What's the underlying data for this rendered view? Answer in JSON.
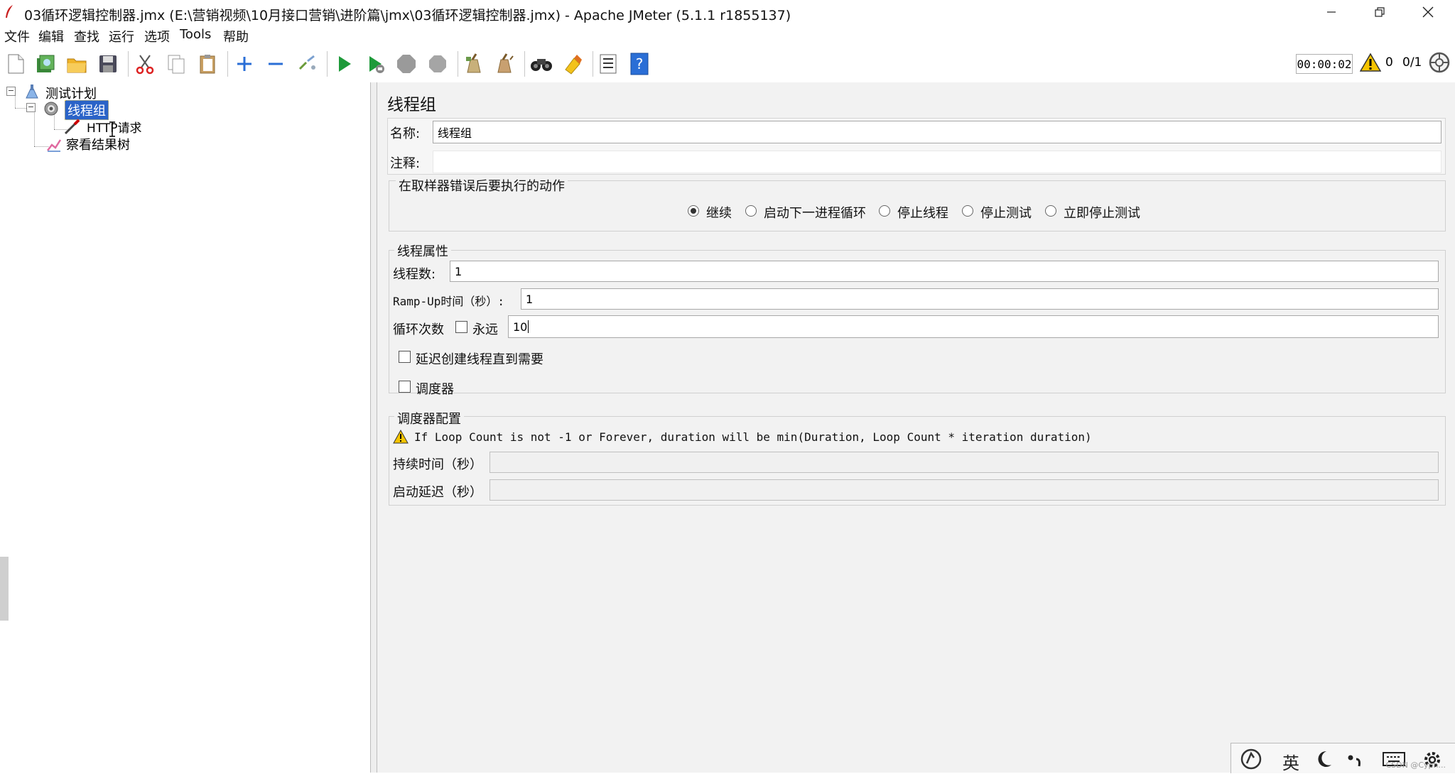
{
  "window": {
    "title": "03循环逻辑控制器.jmx (E:\\营销视频\\10月接口营销\\进阶篇\\jmx\\03循环逻辑控制器.jmx) - Apache JMeter (5.1.1 r1855137)"
  },
  "menu": [
    "文件",
    "编辑",
    "查找",
    "运行",
    "选项",
    "Tools",
    "帮助"
  ],
  "toolbar": {
    "icons": [
      "new-icon",
      "templates-icon",
      "open-icon",
      "save-icon",
      "cut-icon",
      "copy-icon",
      "paste-icon",
      "expand-icon",
      "collapse-icon",
      "toggle-icon",
      "start-icon",
      "start-no-pause-icon",
      "stop-icon",
      "shutdown-icon",
      "clear-icon",
      "clear-all-icon",
      "search-icon",
      "reset-search-icon",
      "function-helper-icon",
      "help-icon"
    ],
    "timer": "00:00:02",
    "warnings": "0",
    "threads": "0/1"
  },
  "tree": {
    "test_plan": "测试计划",
    "thread_group": "线程组",
    "http_request": "HTTP请求",
    "result_tree": "察看结果树"
  },
  "panel": {
    "title": "线程组",
    "name_label": "名称:",
    "name_value": "线程组",
    "comment_label": "注释:",
    "comment_value": "",
    "error_group_title": "在取样器错误后要执行的动作",
    "error_actions": [
      "继续",
      "启动下一进程循环",
      "停止线程",
      "停止测试",
      "立即停止测试"
    ],
    "selected_action": "继续",
    "thread_props_title": "线程属性",
    "threads_label": "线程数:",
    "threads_value": "1",
    "rampup_label": "Ramp-Up时间（秒）:",
    "rampup_value": "1",
    "loop_label": "循环次数",
    "forever_label": "永远",
    "loop_value": "10",
    "delay_create_label": "延迟创建线程直到需要",
    "scheduler_label": "调度器",
    "scheduler_config_title": "调度器配置",
    "scheduler_note": "If Loop Count is not -1 or Forever, duration will be min(Duration, Loop Count * iteration duration)",
    "duration_label": "持续时间（秒）",
    "duration_value": "",
    "startup_delay_label": "启动延迟（秒）",
    "startup_delay_value": ""
  },
  "ime": {
    "lang": "英",
    "watermark": "CSDN @Cyph..."
  }
}
